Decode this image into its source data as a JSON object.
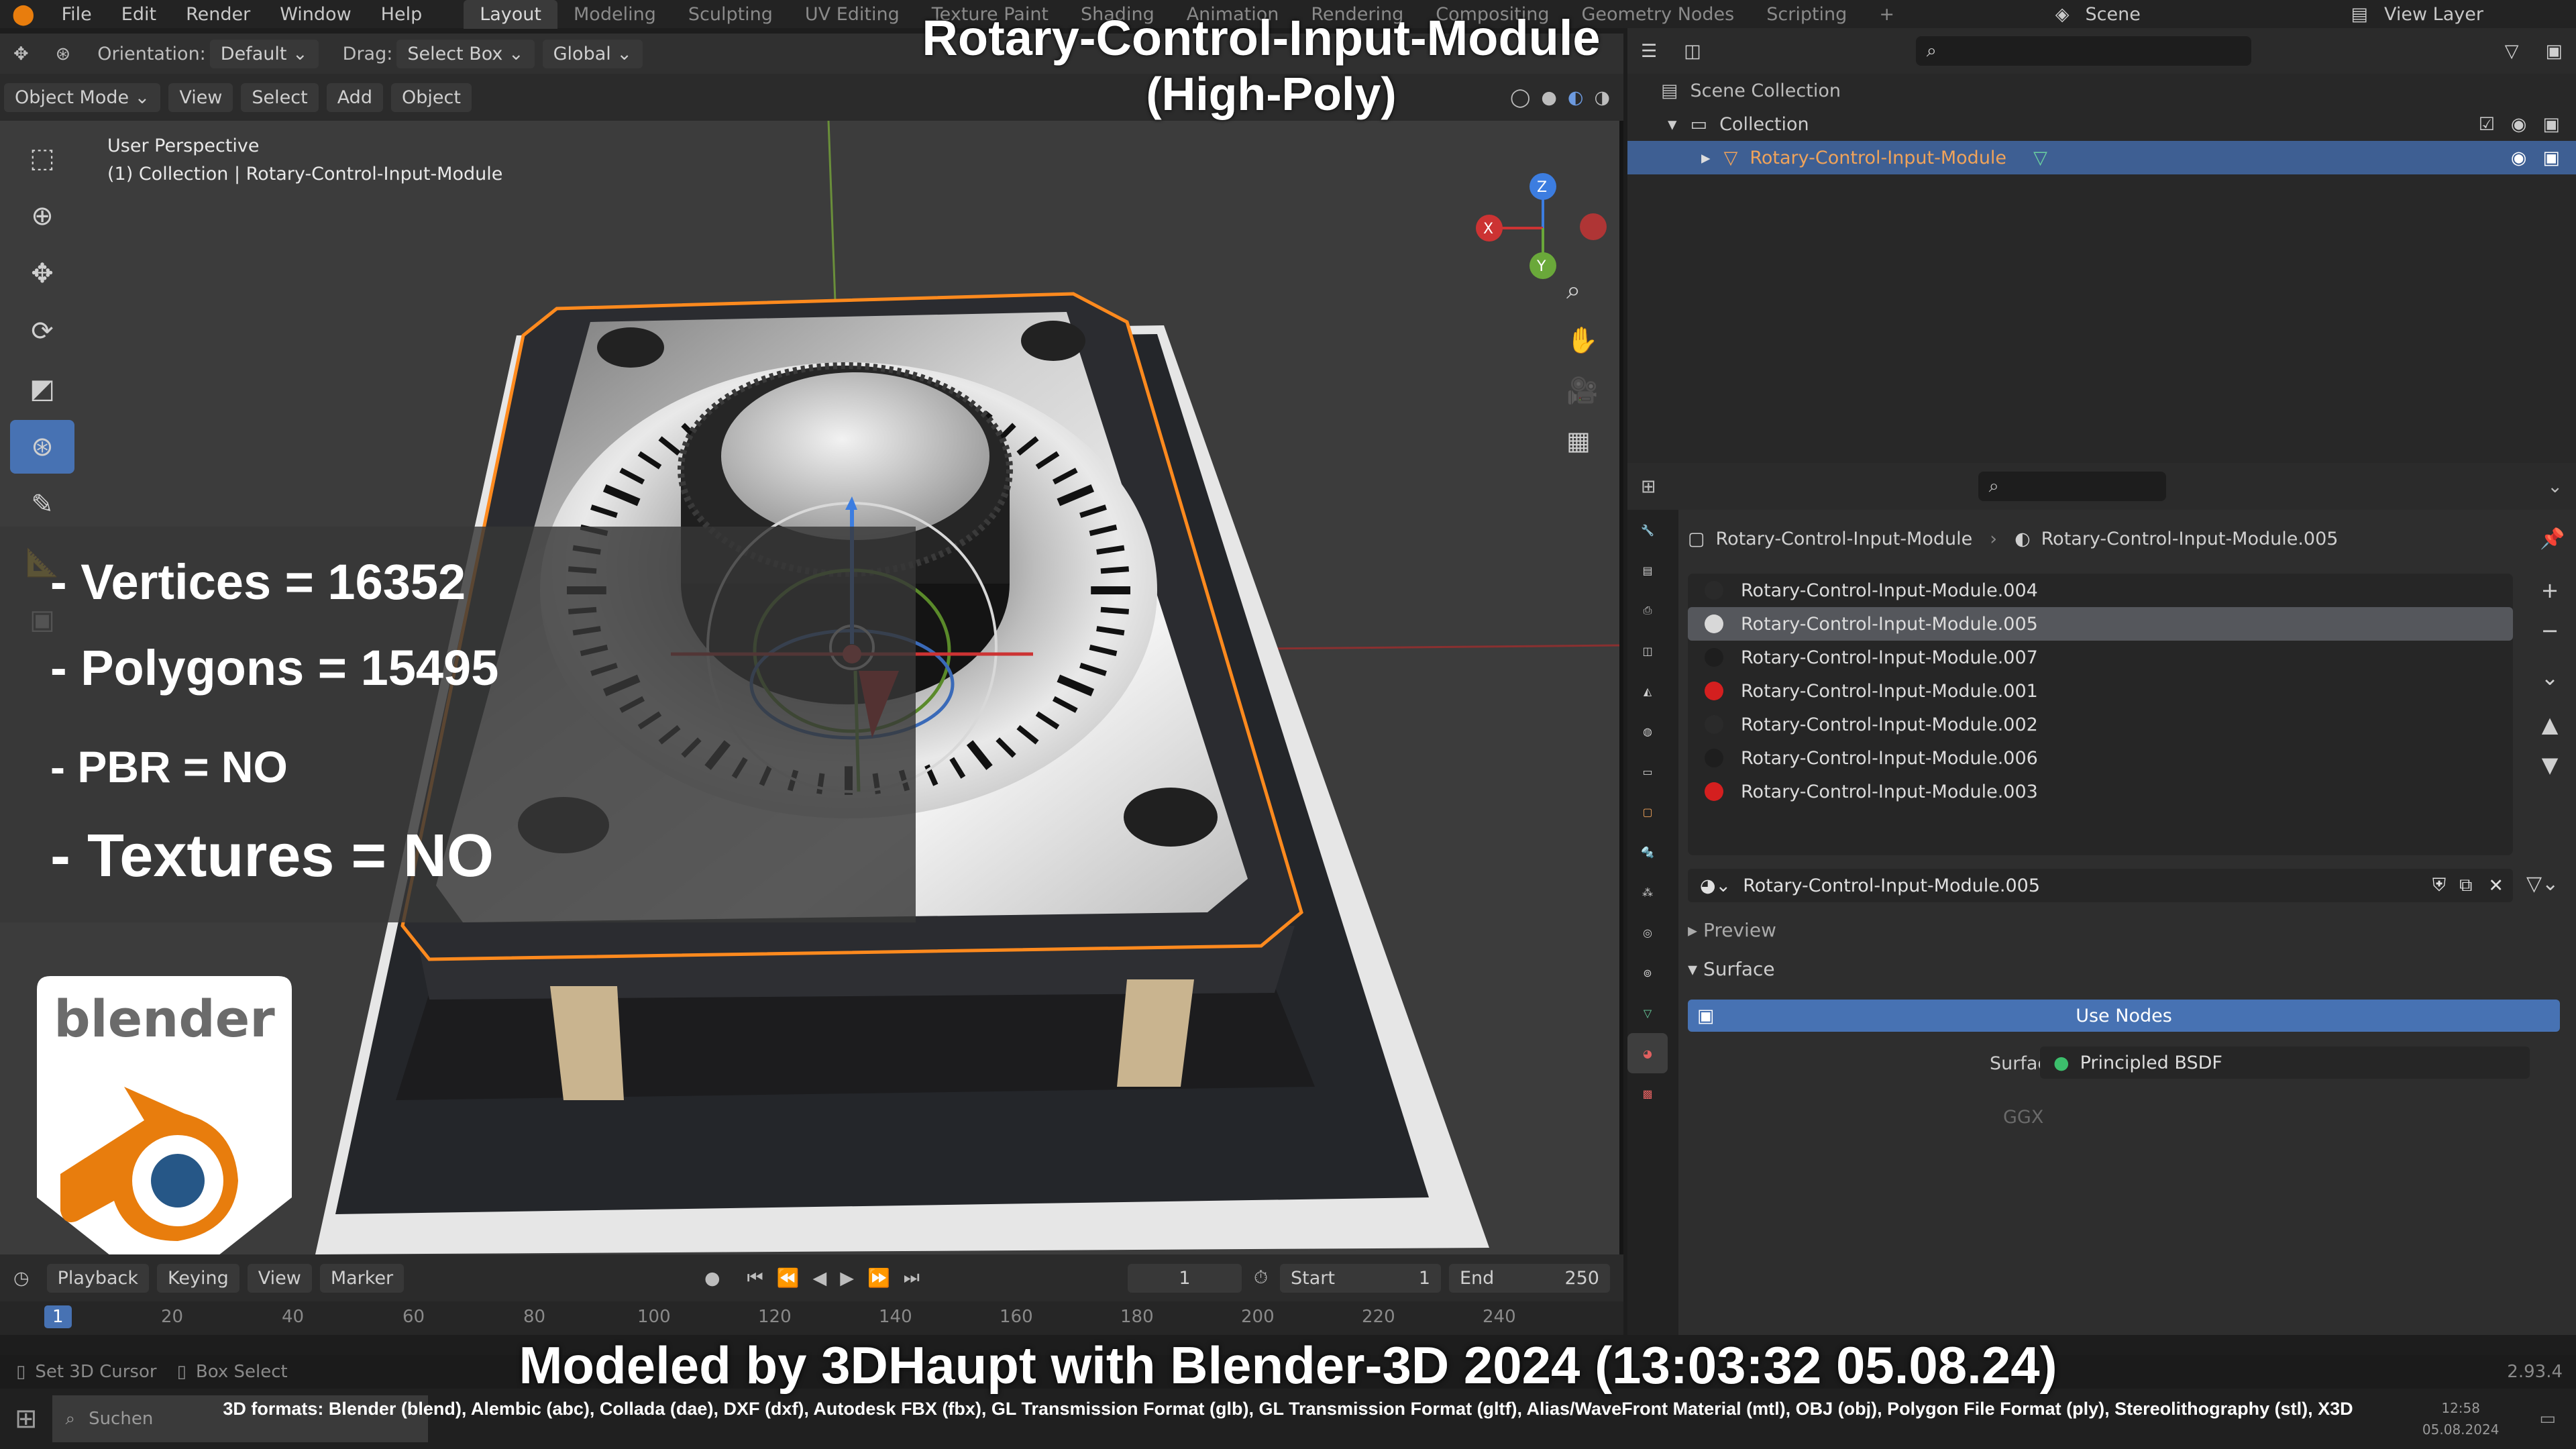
{
  "app": {
    "menus": [
      "File",
      "Edit",
      "Render",
      "Window",
      "Help"
    ],
    "workspaces": [
      "Layout",
      "Modeling",
      "Sculpting",
      "UV Editing",
      "Texture Paint",
      "Shading",
      "Animation",
      "Rendering",
      "Compositing",
      "Geometry Nodes",
      "Scripting"
    ],
    "scene_label": "Scene",
    "view_layer_label": "View Layer"
  },
  "header": {
    "orientation_label": "Orientation:",
    "orientation_value": "Default",
    "drag_label": "Drag:",
    "drag_value": "Select Box",
    "transform_value": "Global",
    "mode": "Object Mode",
    "view_menus": [
      "View",
      "Select",
      "Add",
      "Object"
    ]
  },
  "viewport": {
    "perspective": "User Perspective",
    "collection_info": "(1) Collection | Rotary-Control-Input-Module",
    "gizmo_axes": {
      "x": "X",
      "y": "Y",
      "z": "Z"
    },
    "model_colors": {
      "base": "#232427",
      "plate": "#d9d9d9",
      "outline": "#ff8a1e",
      "legs": "#c9b48f",
      "sheet": "#e8e8e8"
    }
  },
  "overlay": {
    "title": "Rotary-Control-Input-Module",
    "subtitle": "(High-Poly)",
    "stats": [
      "- Vertices = 16352",
      "- Polygons = 15495",
      "- PBR =  NO",
      "- Textures = NO"
    ],
    "logo_text": "blender",
    "credit": "Modeled by 3DHaupt with Blender-3D 2024 (13:03:32  05.08.24)",
    "formats": "3D formats: Blender (blend), Alembic (abc), Collada (dae), DXF (dxf), Autodesk FBX (fbx), GL Transmission Format (glb), GL Transmission Format (gltf), Alias/WaveFront Material (mtl), OBJ (obj), Polygon File Format (ply), Stereolithography (stl), X3D"
  },
  "outliner": {
    "root": "Scene Collection",
    "collection": "Collection",
    "object": "Rotary-Control-Input-Module"
  },
  "properties": {
    "breadcrumb_object": "Rotary-Control-Input-Module",
    "breadcrumb_material": "Rotary-Control-Input-Module.005",
    "materials": [
      {
        "name": "Rotary-Control-Input-Module.004",
        "color": "#2a2a2a"
      },
      {
        "name": "Rotary-Control-Input-Module.005",
        "color": "#d8d8d8"
      },
      {
        "name": "Rotary-Control-Input-Module.007",
        "color": "#1e1e1e"
      },
      {
        "name": "Rotary-Control-Input-Module.001",
        "color": "#d41f1f"
      },
      {
        "name": "Rotary-Control-Input-Module.002",
        "color": "#2a2a2a"
      },
      {
        "name": "Rotary-Control-Input-Module.006",
        "color": "#1e1e1e"
      },
      {
        "name": "Rotary-Control-Input-Module.003",
        "color": "#d41f1f"
      }
    ],
    "active_material": "Rotary-Control-Input-Module.005",
    "preview_label": "Preview",
    "surface_label": "Surface",
    "use_nodes": "Use Nodes",
    "surface_field_label": "Surface",
    "surface_value": "Principled BSDF",
    "ggx": "GGX",
    "accent": "#4772b3"
  },
  "timeline": {
    "menus": [
      "Playback",
      "Keying",
      "View",
      "Marker"
    ],
    "frame": "1",
    "start_label": "Start",
    "start": "1",
    "end_label": "End",
    "end": "250",
    "ticks": [
      "20",
      "40",
      "60",
      "80",
      "100",
      "120",
      "140",
      "160",
      "180",
      "200",
      "220",
      "240"
    ]
  },
  "statusbar": {
    "items": [
      "Set 3D Cursor",
      "Box Select"
    ],
    "search": "Suchen",
    "time": "12:58",
    "date": "05.08.2024",
    "version": "2.93.4"
  }
}
